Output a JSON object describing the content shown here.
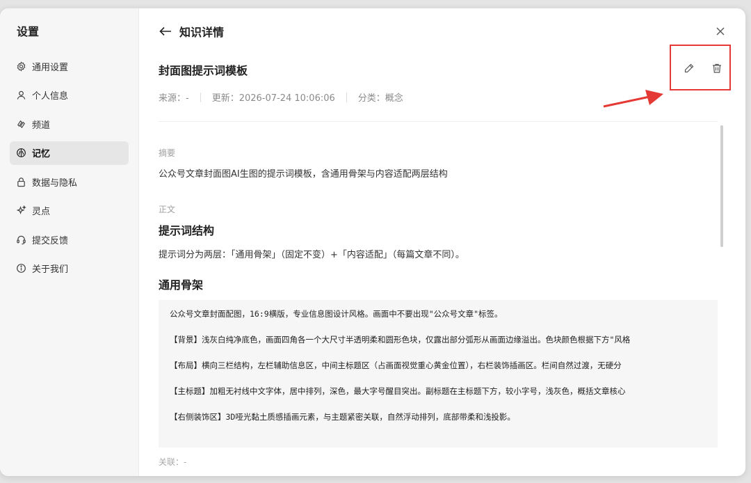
{
  "sidebar": {
    "title": "设置",
    "items": [
      {
        "label": "通用设置",
        "icon": "gear-icon"
      },
      {
        "label": "个人信息",
        "icon": "user-icon"
      },
      {
        "label": "频道",
        "icon": "channel-icon"
      },
      {
        "label": "记忆",
        "icon": "memory-icon"
      },
      {
        "label": "数据与隐私",
        "icon": "lock-icon"
      },
      {
        "label": "灵点",
        "icon": "sparkle-icon"
      },
      {
        "label": "提交反馈",
        "icon": "headset-icon"
      },
      {
        "label": "关于我们",
        "icon": "info-icon"
      }
    ],
    "active_index": 3
  },
  "header": {
    "title": "知识详情"
  },
  "doc": {
    "title": "封面图提示词模板",
    "meta": {
      "source": "来源：-",
      "updated": "更新：2026-07-24 10:06:06",
      "category": "分类：概念"
    },
    "summary_label": "摘要",
    "summary": "公众号文章封面图AI生图的提示词模板，含通用骨架与内容适配两层结构",
    "body_label": "正文",
    "heading1": "提示词结构",
    "para1": "提示词分为两层：「通用骨架」（固定不变）+「内容适配」（每篇文章不同）。",
    "heading2": "通用骨架",
    "code_lines": [
      "公众号文章封面配图，16:9横版，专业信息图设计风格。画面中不要出现\"公众号文章\"标签。",
      "【背景】浅灰白纯净底色，画面四角各一个大尺寸半透明柔和圆形色块，仅露出部分弧形从画面边缘溢出。色块颜色根据下方\"风格",
      "【布局】横向三栏结构，左栏辅助信息区，中间主标题区（占画面视觉重心黄金位置），右栏装饰插画区。栏间自然过渡，无硬分",
      "【主标题】加粗无衬线中文字体，居中排列，深色，最大字号醒目突出。副标题在主标题下方，较小字号，浅灰色，概括文章核心",
      "【右侧装饰区】3D哑光黏土质感插画元素，与主题紧密关联，自然浮动排列，底部带柔和浅投影。"
    ],
    "related": "关联：-"
  },
  "colors": {
    "highlight": "#e53935",
    "sidebar_bg": "#f6f6f6",
    "active_bg": "#e6e6e6"
  }
}
